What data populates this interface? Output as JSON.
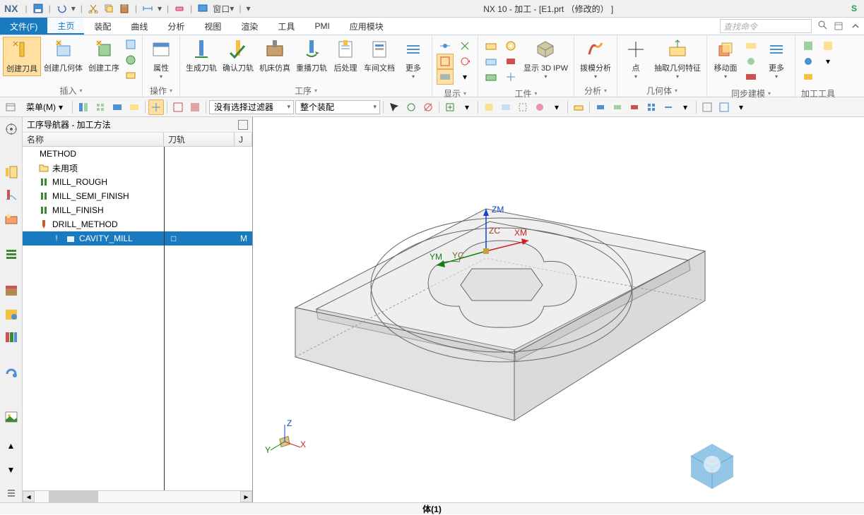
{
  "app": {
    "logo": "NX",
    "title": "NX 10 - 加工 - [E1.prt （修改的） ]",
    "siemens": "S"
  },
  "titlebar": {
    "window_menu": "窗口",
    "icons": [
      "save",
      "undo",
      "cut",
      "copy",
      "paste",
      "dim",
      "eraser",
      "screen"
    ]
  },
  "tabs": {
    "file": "文件(F)",
    "items": [
      "主页",
      "装配",
      "曲线",
      "分析",
      "视图",
      "渲染",
      "工具",
      "PMI",
      "应用模块"
    ],
    "active": "主页",
    "search_placeholder": "查找命令"
  },
  "ribbon": {
    "groups": [
      {
        "name": "insert",
        "label": "插入",
        "buttons": [
          {
            "id": "create-tool",
            "label": "创建刀具",
            "active": true
          },
          {
            "id": "create-geom",
            "label": "创建几何体"
          },
          {
            "id": "create-op",
            "label": "创建工序"
          },
          {
            "id": "small-col1",
            "stack": true
          }
        ]
      },
      {
        "name": "action",
        "label": "操作",
        "buttons": [
          {
            "id": "properties",
            "label": "属性"
          }
        ]
      },
      {
        "name": "process",
        "label": "工序",
        "buttons": [
          {
            "id": "gen-path",
            "label": "生成刀轨"
          },
          {
            "id": "confirm-path",
            "label": "确认刀轨"
          },
          {
            "id": "machine-sim",
            "label": "机床仿真"
          },
          {
            "id": "replay-path",
            "label": "重播刀轨"
          },
          {
            "id": "postprocess",
            "label": "后处理"
          },
          {
            "id": "shop-doc",
            "label": "车间文档"
          },
          {
            "id": "more1",
            "label": "更多"
          }
        ]
      },
      {
        "name": "display",
        "label": "显示",
        "buttons": []
      },
      {
        "name": "part",
        "label": "工件",
        "buttons": [
          {
            "id": "show-3dipw",
            "label": "显示 3D IPW"
          }
        ]
      },
      {
        "name": "analysis",
        "label": "分析",
        "buttons": [
          {
            "id": "gouge-analysis",
            "label": "拨模分析"
          }
        ]
      },
      {
        "name": "geom",
        "label": "几何体",
        "buttons": [
          {
            "id": "point",
            "label": "点"
          },
          {
            "id": "extract-feat",
            "label": "抽取几何特征"
          }
        ]
      },
      {
        "name": "sync",
        "label": "同步建模",
        "buttons": [
          {
            "id": "move-face",
            "label": "移动面"
          },
          {
            "id": "more2",
            "label": "更多"
          }
        ]
      },
      {
        "name": "mfg-tools",
        "label": "加工工具",
        "buttons": []
      }
    ]
  },
  "toolbar": {
    "menu_label": "菜单(M)",
    "filter1": "没有选择过滤器",
    "filter2": "整个装配"
  },
  "navigator": {
    "title": "工序导航器 - 加工方法",
    "col_name": "名称",
    "col_track": "刀轨",
    "col_j": "J",
    "tree": [
      {
        "level": 0,
        "icon": "method",
        "label": "METHOD",
        "selected": false
      },
      {
        "level": 1,
        "icon": "folder",
        "label": "未用项",
        "selected": false
      },
      {
        "level": 1,
        "icon": "mill",
        "label": "MILL_ROUGH",
        "selected": false
      },
      {
        "level": 1,
        "icon": "mill",
        "label": "MILL_SEMI_FINISH",
        "selected": false
      },
      {
        "level": 1,
        "icon": "mill",
        "label": "MILL_FINISH",
        "selected": false
      },
      {
        "level": 1,
        "icon": "drill",
        "label": "DRILL_METHOD",
        "selected": false
      },
      {
        "level": 2,
        "icon": "cavity",
        "label": "CAVITY_MILL",
        "selected": true,
        "warn": true,
        "track": "□",
        "j": "M"
      }
    ]
  },
  "viewport": {
    "axes": {
      "zm": "ZM",
      "zc": "ZC",
      "xm": "XM",
      "ym": "YM",
      "yc": "YC"
    },
    "triad": {
      "x": "X",
      "y": "Y",
      "z": "Z"
    }
  },
  "status": "体(1)"
}
